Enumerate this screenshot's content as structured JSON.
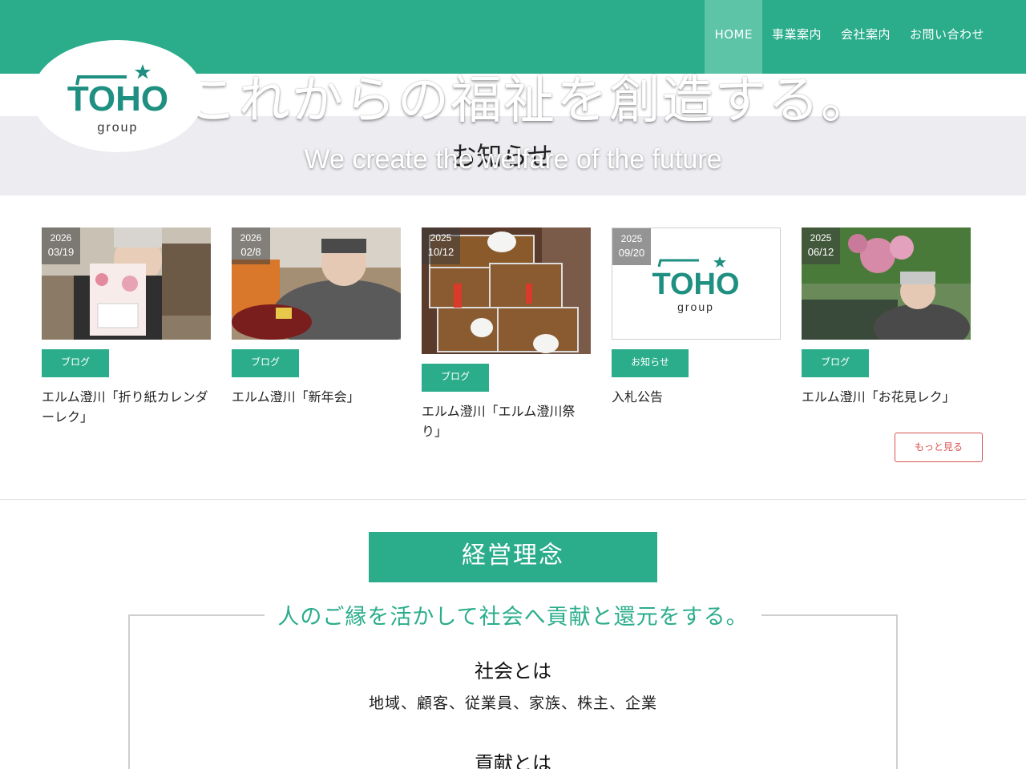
{
  "nav": {
    "items": [
      {
        "label": "HOME"
      },
      {
        "label": "事業案内"
      },
      {
        "label": "会社案内"
      },
      {
        "label": "お問い合わせ"
      }
    ]
  },
  "logo": {
    "text": "TOHO",
    "sub": "group"
  },
  "hero": {
    "title": "これからの福祉を創造する。",
    "subtitle": "We create the welfare of the future"
  },
  "news": {
    "heading": "お知らせ",
    "items": [
      {
        "year": "2026",
        "date": "03/19",
        "category": "ブログ",
        "title": "エルム澄川「折り紙カレンダーレク」"
      },
      {
        "year": "2026",
        "date": "02/8",
        "category": "ブログ",
        "title": "エルム澄川「新年会」"
      },
      {
        "year": "2025",
        "date": "10/12",
        "category": "ブログ",
        "title": "エルム澄川「エルム澄川祭り」"
      },
      {
        "year": "2025",
        "date": "09/20",
        "category": "お知らせ",
        "title": "入札公告"
      },
      {
        "year": "2025",
        "date": "06/12",
        "category": "ブログ",
        "title": "エルム澄川「お花見レク」"
      }
    ],
    "more_label": "もっと見る"
  },
  "philosophy": {
    "label": "経営理念",
    "tagline": "人のご縁を活かして社会へ貢献と還元をする。",
    "sections": [
      {
        "heading": "社会とは",
        "body": "地域、顧客、従業員、家族、株主、企業"
      },
      {
        "heading": "貢献とは",
        "body": ""
      }
    ]
  },
  "colors": {
    "brand": "#2bad8c",
    "nav_active": "#5ec4a8",
    "more": "#d9534f",
    "band": "#ededf1"
  }
}
